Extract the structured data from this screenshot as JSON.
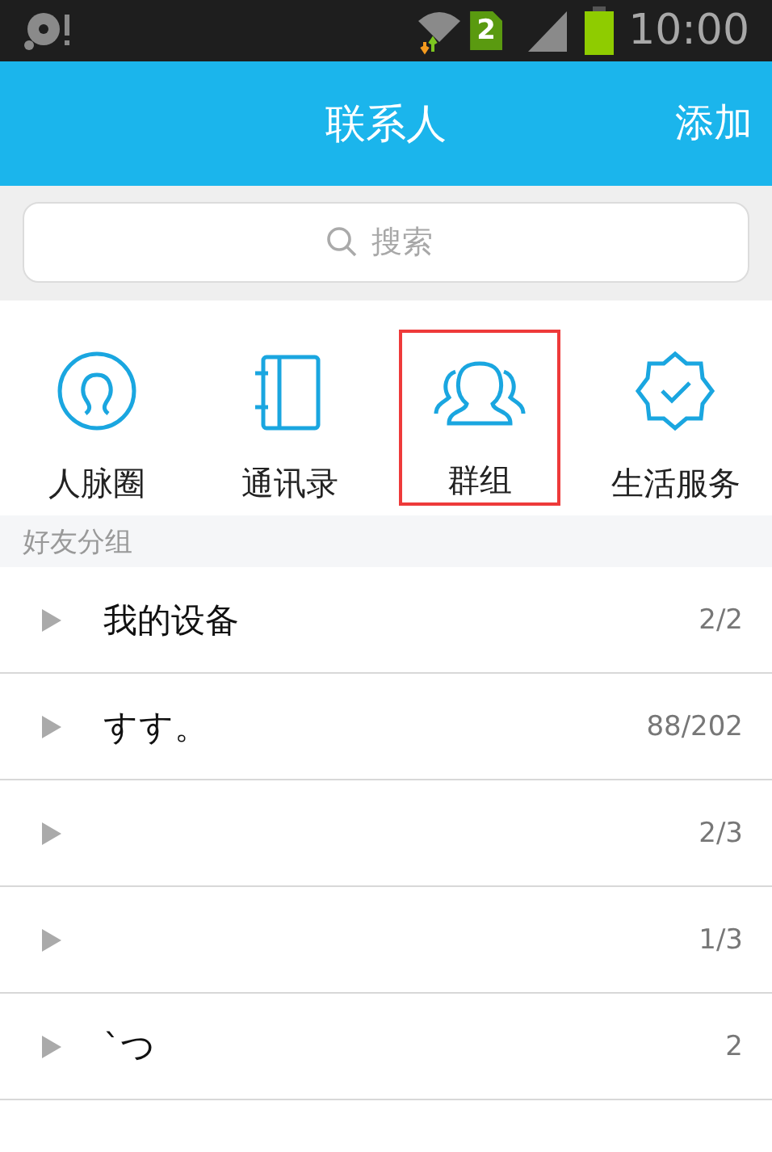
{
  "status_bar": {
    "time": "10:00",
    "sim_badge": "2"
  },
  "header": {
    "title": "联系人",
    "action": "添加"
  },
  "search": {
    "placeholder": "搜索"
  },
  "shortcuts": [
    {
      "kind": "circle",
      "label": "人脉圈",
      "highlighted": false
    },
    {
      "kind": "book",
      "label": "通讯录",
      "highlighted": false
    },
    {
      "kind": "people",
      "label": "群组",
      "highlighted": true
    },
    {
      "kind": "badge",
      "label": "生活服务",
      "highlighted": false
    }
  ],
  "section": {
    "title": "好友分组"
  },
  "groups": [
    {
      "name": "我的设备",
      "count": "2/2"
    },
    {
      "name": "すす。",
      "count": "88/202"
    },
    {
      "count": "2/3"
    },
    {
      "count": "1/3"
    },
    {
      "name": "`つ",
      "count": "2"
    }
  ]
}
